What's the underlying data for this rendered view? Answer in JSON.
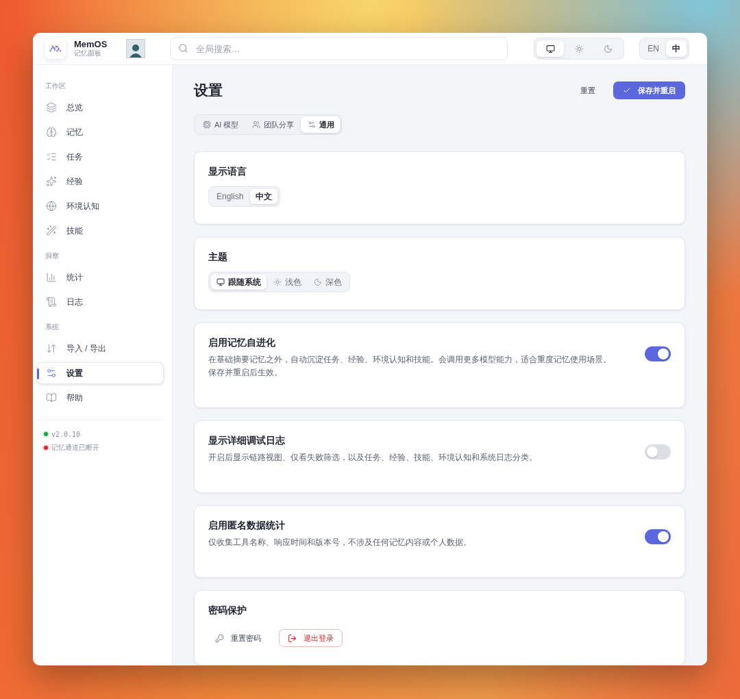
{
  "brand": {
    "name": "MemOS",
    "subtitle": "记忆面板"
  },
  "search": {
    "placeholder": "全局搜索..."
  },
  "theme_switch": [
    {
      "kind": "monitor",
      "selected": true
    },
    {
      "kind": "sun",
      "selected": false
    },
    {
      "kind": "moon",
      "selected": false
    }
  ],
  "language_switch": [
    {
      "label": "EN",
      "selected": false
    },
    {
      "label": "中",
      "selected": true
    }
  ],
  "sidebar": {
    "sections": [
      {
        "title": "工作区",
        "items": [
          {
            "label": "总览",
            "selected": false
          },
          {
            "label": "记忆",
            "selected": false
          },
          {
            "label": "任务",
            "selected": false
          },
          {
            "label": "经验",
            "selected": false
          },
          {
            "label": "环境认知",
            "selected": false
          },
          {
            "label": "技能",
            "selected": false
          }
        ]
      },
      {
        "title": "洞察",
        "items": [
          {
            "label": "统计",
            "selected": false
          },
          {
            "label": "日志",
            "selected": false
          }
        ]
      },
      {
        "title": "系统",
        "items": [
          {
            "label": "导入 / 导出",
            "selected": false
          },
          {
            "label": "设置",
            "selected": true
          },
          {
            "label": "帮助",
            "selected": false
          }
        ]
      }
    ],
    "status": [
      {
        "text": "v2.0.10",
        "color": "#16a34a"
      },
      {
        "text": "记忆通道已断开",
        "color": "#dc2626"
      }
    ]
  },
  "page": {
    "title": "设置",
    "reset_button": "重置",
    "save_button": "保存并重启"
  },
  "tabs": [
    {
      "label": "AI 模型",
      "selected": false
    },
    {
      "label": "团队分享",
      "selected": false
    },
    {
      "label": "通用",
      "selected": true
    }
  ],
  "cards": [
    {
      "kind": "segmented",
      "title": "显示语言",
      "options": [
        {
          "label": "English",
          "selected": false
        },
        {
          "label": "中文",
          "selected": true
        }
      ]
    },
    {
      "kind": "segmented",
      "title": "主题",
      "options": [
        {
          "label": "跟随系统",
          "selected": true
        },
        {
          "label": "浅色",
          "selected": false
        },
        {
          "label": "深色",
          "selected": false
        }
      ]
    },
    {
      "kind": "toggle",
      "title": "启用记忆自进化",
      "description": "在基础摘要记忆之外，自动沉淀任务、经验、环境认知和技能。会调用更多模型能力，适合重度记忆使用场景。保存并重启后生效。",
      "on": true
    },
    {
      "kind": "toggle",
      "title": "显示详细调试日志",
      "description": "开启后显示链路视图、仅看失败筛选，以及任务、经验、技能、环境认知和系统日志分类。",
      "on": false
    },
    {
      "kind": "toggle",
      "title": "启用匿名数据统计",
      "description": "仅收集工具名称、响应时间和版本号，不涉及任何记忆内容或个人数据。",
      "on": true
    },
    {
      "kind": "actions",
      "title": "密码保护",
      "reset_password": "重置密码",
      "logout": "退出登录"
    }
  ]
}
